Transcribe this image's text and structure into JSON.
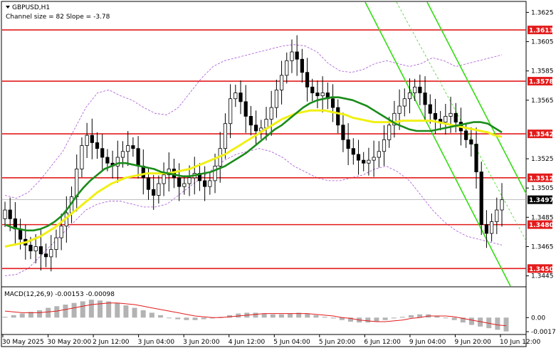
{
  "header": {
    "symbol": "GBPUSD,H1",
    "channel_note": "Channel size = 82 Slope = -3.78"
  },
  "macd": {
    "label": "MACD(12,26,9) -0.00153 -0.00098",
    "axis_labels": [
      "0.00",
      "-0.00173"
    ],
    "axis_values": [
      0.0,
      -0.00173
    ],
    "hist": [
      0.0001,
      0.0003,
      0.0005,
      0.0007,
      0.0009,
      0.0012,
      0.0014,
      0.0016,
      0.0018,
      0.002,
      0.0022,
      0.0021,
      0.002,
      0.0018,
      0.0015,
      0.0012,
      0.0009,
      0.0006,
      0.0003,
      0.0,
      -0.0002,
      -0.0003,
      -0.0003,
      -0.0002,
      -0.0001,
      0.0001,
      0.0003,
      0.0005,
      0.0006,
      0.0006,
      0.0005,
      0.0004,
      0.0004,
      0.0005,
      0.0006,
      0.0005,
      0.0003,
      0.0001,
      -0.0001,
      -0.0003,
      -0.0005,
      -0.0006,
      -0.0006,
      -0.0005,
      -0.0003,
      -0.0001,
      0.0001,
      0.0003,
      0.0004,
      0.0004,
      0.0002,
      0.0,
      -0.0003,
      -0.0006,
      -0.0009,
      -0.0011,
      -0.0013,
      -0.0015,
      -0.0017
    ],
    "signal": [
      0.0008,
      0.0007,
      0.0006,
      0.0006,
      0.0006,
      0.0007,
      0.0008,
      0.001,
      0.0012,
      0.0014,
      0.0016,
      0.0017,
      0.0018,
      0.0018,
      0.0017,
      0.0016,
      0.0014,
      0.0012,
      0.001,
      0.0008,
      0.0006,
      0.0004,
      0.0002,
      0.0001,
      0.0,
      0.0,
      0.0001,
      0.0002,
      0.0003,
      0.0004,
      0.0005,
      0.0005,
      0.0005,
      0.0005,
      0.0005,
      0.0005,
      0.0004,
      0.0003,
      0.0002,
      0.0,
      -0.0001,
      -0.0003,
      -0.0004,
      -0.0005,
      -0.0005,
      -0.0004,
      -0.0003,
      -0.0001,
      0.0,
      0.0002,
      0.0002,
      0.0002,
      0.0001,
      -0.0001,
      -0.0003,
      -0.0005,
      -0.0007,
      -0.0009,
      -0.001
    ]
  },
  "price_axis": {
    "labels": [
      "1.3625",
      "1.3605",
      "1.3585",
      "1.3565",
      "1.3525",
      "1.3505",
      "1.3485",
      "1.3465",
      "1.3445"
    ],
    "values": [
      1.3625,
      1.3605,
      1.3585,
      1.3565,
      1.3525,
      1.3505,
      1.3485,
      1.3465,
      1.3445
    ]
  },
  "time_axis": [
    "30 May 2025",
    "30 May 20:00",
    "2 Jun 12:00",
    "3 Jun 04:00",
    "3 Jun 20:00",
    "4 Jun 12:00",
    "5 Jun 04:00",
    "5 Jun 20:00",
    "6 Jun 12:00",
    "9 Jun 04:00",
    "9 Jun 20:00",
    "10 Jun 12:00"
  ],
  "colors": {
    "level": "#e31b1b",
    "channel": "#33dd11",
    "ma_fast": "#1a8c1a",
    "ma_slow": "#f0f014",
    "bands": "#a855d6",
    "macd_hist": "#b3b3b3",
    "macd_signal": "#e31b1b",
    "current": "#000000"
  },
  "chart_data": {
    "type": "candlestick",
    "title": "GBPUSD,H1",
    "ylim": [
      1.3438,
      1.3632
    ],
    "levels": [
      {
        "label": "1.3613",
        "value": 1.3613
      },
      {
        "label": "1.3578",
        "value": 1.3578
      },
      {
        "label": "1.3542",
        "value": 1.3542
      },
      {
        "label": "1.3512",
        "value": 1.3512
      },
      {
        "label": "1.3480",
        "value": 1.348
      },
      {
        "label": "1.3450",
        "value": 1.345
      }
    ],
    "current_price": {
      "label": "1.3497",
      "value": 1.3497
    },
    "close": [
      1.349,
      1.3484,
      1.3477,
      1.347,
      1.3466,
      1.3462,
      1.3465,
      1.346,
      1.3458,
      1.3463,
      1.3471,
      1.3479,
      1.3488,
      1.3499,
      1.3518,
      1.3534,
      1.3541,
      1.3536,
      1.3532,
      1.3526,
      1.3522,
      1.352,
      1.3526,
      1.353,
      1.3534,
      1.3532,
      1.352,
      1.3512,
      1.3504,
      1.35,
      1.3508,
      1.3514,
      1.3518,
      1.3512,
      1.3506,
      1.3508,
      1.3512,
      1.3515,
      1.351,
      1.3506,
      1.351,
      1.352,
      1.3532,
      1.3549,
      1.3566,
      1.357,
      1.3564,
      1.3554,
      1.3548,
      1.3544,
      1.3546,
      1.3552,
      1.356,
      1.3572,
      1.3582,
      1.3592,
      1.3598,
      1.3593,
      1.3584,
      1.3574,
      1.357,
      1.3568,
      1.357,
      1.3566,
      1.356,
      1.3548,
      1.3538,
      1.3532,
      1.3528,
      1.3524,
      1.3522,
      1.3524,
      1.3526,
      1.353,
      1.3538,
      1.3548,
      1.3556,
      1.3561,
      1.3566,
      1.357,
      1.3574,
      1.357,
      1.3562,
      1.3556,
      1.3552,
      1.355,
      1.3554,
      1.3556,
      1.355,
      1.3544,
      1.3538,
      1.3535,
      1.3516,
      1.348,
      1.3474,
      1.3482,
      1.349,
      1.3497
    ],
    "ma_fast": [
      1.348,
      1.3478,
      1.3477,
      1.3476,
      1.3476,
      1.3477,
      1.3479,
      1.3482,
      1.3486,
      1.3492,
      1.3499,
      1.3505,
      1.351,
      1.3514,
      1.3518,
      1.352,
      1.3522,
      1.3522,
      1.3521,
      1.352,
      1.3519,
      1.3518,
      1.3516,
      1.3515,
      1.3514,
      1.3513,
      1.3513,
      1.3514,
      1.3515,
      1.3516,
      1.3518,
      1.352,
      1.3523,
      1.3526,
      1.3529,
      1.3533,
      1.3537,
      1.3541,
      1.3545,
      1.3548,
      1.3552,
      1.3556,
      1.356,
      1.3563,
      1.3565,
      1.3566,
      1.3567,
      1.3567,
      1.3566,
      1.3565,
      1.3563,
      1.3561,
      1.3558,
      1.3555,
      1.3552,
      1.3549,
      1.3547,
      1.3545,
      1.3544,
      1.3544,
      1.3544,
      1.3545,
      1.3546,
      1.3547,
      1.3548,
      1.3549,
      1.355,
      1.355,
      1.3549,
      1.3546,
      1.3543
    ],
    "ma_slow": [
      1.3465,
      1.3466,
      1.3467,
      1.3468,
      1.347,
      1.3472,
      1.3475,
      1.3478,
      1.3482,
      1.3486,
      1.349,
      1.3494,
      1.3498,
      1.3502,
      1.3505,
      1.3508,
      1.351,
      1.3512,
      1.3513,
      1.3514,
      1.3515,
      1.3515,
      1.3515,
      1.3515,
      1.3516,
      1.3517,
      1.3518,
      1.352,
      1.3522,
      1.3524,
      1.3526,
      1.3528,
      1.3531,
      1.3534,
      1.3537,
      1.354,
      1.3543,
      1.3546,
      1.3549,
      1.3552,
      1.3554,
      1.3556,
      1.3557,
      1.3558,
      1.3558,
      1.3558,
      1.3557,
      1.3556,
      1.3555,
      1.3553,
      1.3552,
      1.3551,
      1.355,
      1.355,
      1.355,
      1.355,
      1.3551,
      1.3551,
      1.3551,
      1.3551,
      1.3551,
      1.355,
      1.3549,
      1.3548,
      1.3547,
      1.3546,
      1.3545,
      1.3544,
      1.3543,
      1.3541,
      1.354
    ],
    "band_upper": [
      1.35,
      1.3498,
      1.3502,
      1.351,
      1.352,
      1.353,
      1.3545,
      1.356,
      1.357,
      1.3572,
      1.3568,
      1.3565,
      1.356,
      1.3556,
      1.3555,
      1.356,
      1.357,
      1.358,
      1.3588,
      1.3592,
      1.3594,
      1.3596,
      1.3598,
      1.36,
      1.3602,
      1.3603,
      1.3602,
      1.3598,
      1.359,
      1.3585,
      1.3584,
      1.3586,
      1.359,
      1.3592,
      1.359,
      1.3588,
      1.359,
      1.3594,
      1.3592,
      1.3588,
      1.359,
      1.3592,
      1.3594,
      1.3596
    ],
    "band_lower": [
      1.3445,
      1.3446,
      1.345,
      1.3458,
      1.3466,
      1.3474,
      1.3482,
      1.349,
      1.3494,
      1.3496,
      1.3496,
      1.3494,
      1.3492,
      1.3492,
      1.3494,
      1.35,
      1.3506,
      1.3512,
      1.3518,
      1.3524,
      1.3528,
      1.353,
      1.3532,
      1.353,
      1.3526,
      1.352,
      1.3516,
      1.3512,
      1.351,
      1.351,
      1.3512,
      1.3514,
      1.3518,
      1.352,
      1.3516,
      1.351,
      1.35,
      1.349,
      1.3482,
      1.3476,
      1.3472,
      1.347,
      1.3468,
      1.3466
    ]
  }
}
